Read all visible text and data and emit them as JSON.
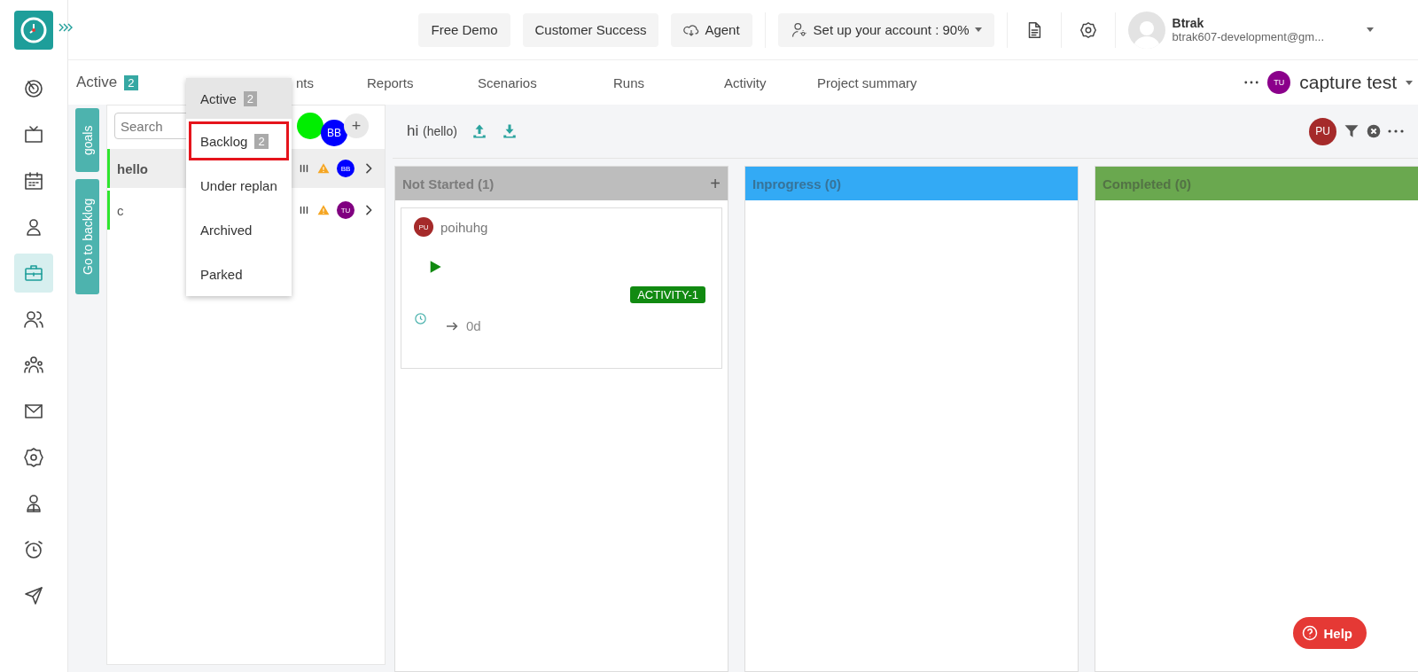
{
  "sidebar": {
    "items": [
      {
        "selected": false
      },
      {
        "selected": false
      },
      {
        "selected": false
      },
      {
        "selected": false
      },
      {
        "selected": true
      },
      {
        "selected": false
      },
      {
        "selected": false
      },
      {
        "selected": false
      },
      {
        "selected": false
      },
      {
        "selected": false
      },
      {
        "selected": false
      },
      {
        "selected": false
      }
    ]
  },
  "header": {
    "buttons": [
      "Free Demo",
      "Customer Success"
    ],
    "agent": "Agent",
    "setup": "Set up your account : 90%",
    "user": {
      "name": "Btrak",
      "email": "btrak607-development@gm..."
    }
  },
  "status_filter": {
    "label": "Active",
    "count": "2"
  },
  "tabs": [
    "nts",
    "Reports",
    "Scenarios",
    "Runs",
    "Activity",
    "Project summary"
  ],
  "project": {
    "avatar": "TU",
    "color": "#8b008b",
    "name": "capture test"
  },
  "side_tabs": [
    "goals",
    "Go to backlog"
  ],
  "goal_search": {
    "placeholder": "Search"
  },
  "members": [
    {
      "color": "#00ee00"
    },
    {
      "initials": "BB",
      "color": "#0000ff"
    }
  ],
  "add_member": "+",
  "goals": [
    {
      "name": "hello",
      "selected": true,
      "avatar": "BB",
      "color": "#0000ff"
    },
    {
      "name": "c",
      "selected": false,
      "avatar": "TU",
      "color": "#800080"
    }
  ],
  "dropdown": {
    "items": [
      {
        "label": "Active",
        "count": "2",
        "selected": true,
        "highlighted": false
      },
      {
        "label": "Backlog",
        "count": "2",
        "selected": false,
        "highlighted": true
      },
      {
        "label": "Under replan",
        "selected": false,
        "highlighted": false
      },
      {
        "label": "Archived",
        "selected": false,
        "highlighted": false
      },
      {
        "label": "Parked",
        "selected": false,
        "highlighted": false
      }
    ]
  },
  "board": {
    "title": "hi",
    "subtitle": "(hello)",
    "avatar": "PU",
    "color": "#a52a2a",
    "columns": [
      {
        "title": "Not Started (1)",
        "color": "#bdbdbd",
        "addable": true,
        "cards": [
          {
            "avatar": "PU",
            "color": "#a52a2a",
            "title": "poihuhg",
            "tag": "ACTIVITY-1",
            "estimate": "0d"
          }
        ]
      },
      {
        "title": "Inprogress (0)",
        "color": "#33aaf5",
        "addable": false
      },
      {
        "title": "Completed (0)",
        "color": "#6aa84f",
        "addable": false
      }
    ]
  },
  "help": "Help"
}
